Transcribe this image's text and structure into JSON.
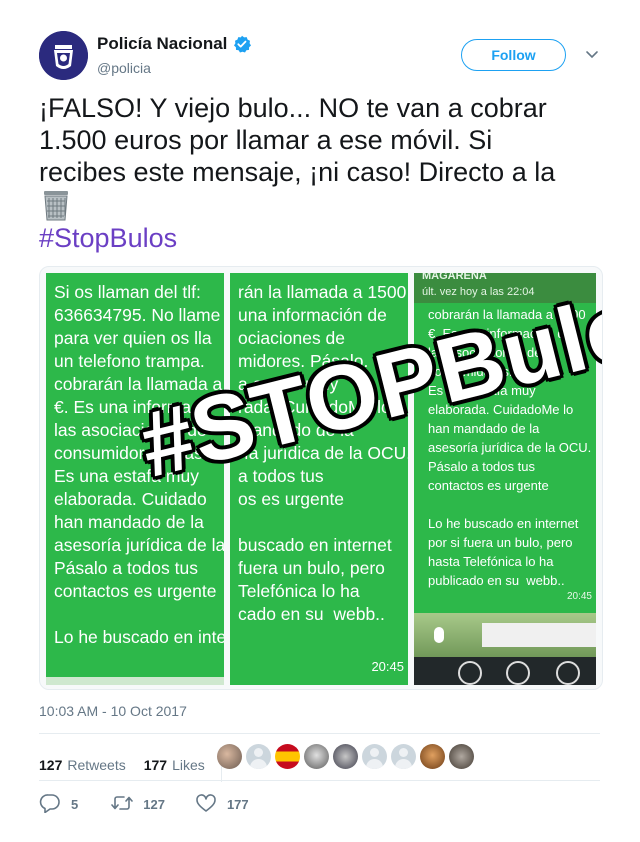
{
  "tweet": {
    "author": {
      "name": "Policía Nacional",
      "handle": "@policia",
      "verified": true
    },
    "follow_label": "Follow",
    "text_lines": [
      "¡FALSO! Y viejo bulo... NO te van a cobrar",
      "1.500 euros por llamar a ese móvil. Si",
      "recibes este mensaje, ¡ni caso! Directo a la"
    ],
    "trash_emoji": "wastebasket-icon",
    "hashtag": "#StopBulos",
    "timestamp": "10:03 AM - 10 Oct 2017"
  },
  "media": {
    "watermark": "#STOPBulos",
    "panel1_text": "Si os llaman del tlf:\n636634795. No llame\npara ver quien os lla\nun telefono trampa.\ncobrarán la llamada a\n€. Es una informació\nlas asociaciones de\nconsumidores. Pása\nEs una estafa muy\nelaborada. Cuidado\nhan mandado de la\nasesoría jurídica de la\nPásalo a todos tus\ncontactos es urgente\n\nLo he buscado en inte",
    "panel2_text": "rán la llamada a 1500\nuna información de\nociaciones de\nmidores. Pásalo.\na estafa muy\nrada. CuidadoMe lo\nmandado de la\nría jurídica de la OCU.\na todos tus\nos es urgente\n\nbuscado en internet\nfuera un bulo, pero\nTelefónica lo ha\ncado en su  webb..",
    "panel2_time": "20:45",
    "panel3_header_name": "MAGARENA",
    "panel3_header_status": "últ. vez hoy a las 22:04",
    "panel3_text": "cobrarán la llamada a 1500\n€. Es una información de\nlas asociaciones de\nconsumidores. Pásalo.\nEs una estafa muy\nelaborada. CuidadoMe lo\nhan mandado de la\nasesoría jurídica de la OCU.\nPásalo a todos tus\ncontactos es urgente\n\nLo he buscado en internet\npor si fuera un bulo, pero\nhasta Telefónica lo ha\npublicado en su  webb..",
    "panel3_time": "20:45"
  },
  "stats": {
    "retweets_count": "127",
    "retweets_label": "Retweets",
    "likes_count": "177",
    "likes_label": "Likes"
  },
  "actions": {
    "reply_count": "5",
    "retweet_count": "127",
    "like_count": "177"
  },
  "colors": {
    "accent": "#1da1f2",
    "hashtag": "#6b3fc4",
    "whatsapp_green": "#2db84a"
  }
}
